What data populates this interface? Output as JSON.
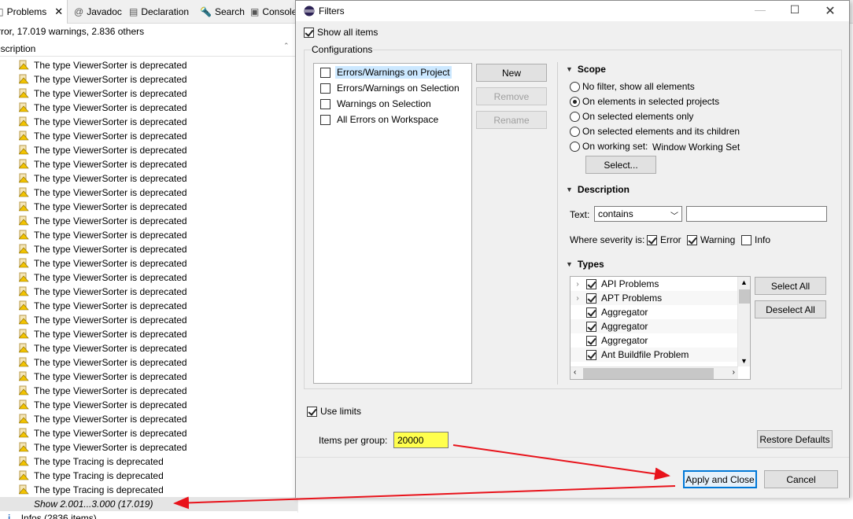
{
  "view": {
    "tabs": [
      {
        "label": "Problems"
      },
      {
        "label": "Javadoc"
      },
      {
        "label": "Declaration"
      },
      {
        "label": "Search"
      },
      {
        "label": "Console"
      }
    ],
    "summary": "rror, 17.019 warnings, 2.836 others",
    "column_header": "escription",
    "rows": [
      "The type ViewerSorter is deprecated",
      "The type ViewerSorter is deprecated",
      "The type ViewerSorter is deprecated",
      "The type ViewerSorter is deprecated",
      "The type ViewerSorter is deprecated",
      "The type ViewerSorter is deprecated",
      "The type ViewerSorter is deprecated",
      "The type ViewerSorter is deprecated",
      "The type ViewerSorter is deprecated",
      "The type ViewerSorter is deprecated",
      "The type ViewerSorter is deprecated",
      "The type ViewerSorter is deprecated",
      "The type ViewerSorter is deprecated",
      "The type ViewerSorter is deprecated",
      "The type ViewerSorter is deprecated",
      "The type ViewerSorter is deprecated",
      "The type ViewerSorter is deprecated",
      "The type ViewerSorter is deprecated",
      "The type ViewerSorter is deprecated",
      "The type ViewerSorter is deprecated",
      "The type ViewerSorter is deprecated",
      "The type ViewerSorter is deprecated",
      "The type ViewerSorter is deprecated",
      "The type ViewerSorter is deprecated",
      "The type ViewerSorter is deprecated",
      "The type ViewerSorter is deprecated",
      "The type ViewerSorter is deprecated",
      "The type ViewerSorter is deprecated",
      "The type Tracing is deprecated",
      "The type Tracing is deprecated",
      "The type Tracing is deprecated"
    ],
    "show_more": "Show 2.001...3.000 (17.019)",
    "infos": "Infos (2836 items)"
  },
  "dialog": {
    "title": "Filters",
    "show_all_items": "Show all items",
    "configurations_label": "Configurations",
    "configurations": [
      {
        "label": "Errors/Warnings on Project",
        "checked": false,
        "selected": true
      },
      {
        "label": "Errors/Warnings on Selection",
        "checked": false,
        "selected": false
      },
      {
        "label": "Warnings on Selection",
        "checked": false,
        "selected": false
      },
      {
        "label": "All Errors on Workspace",
        "checked": false,
        "selected": false
      }
    ],
    "buttons": {
      "new": "New",
      "remove": "Remove",
      "rename": "Rename"
    },
    "scope": {
      "title": "Scope",
      "options": [
        "No filter, show all elements",
        "On elements in selected projects",
        "On selected elements only",
        "On selected elements and its children",
        "On working set:"
      ],
      "selected_index": 1,
      "working_set": "Window Working Set",
      "select_button": "Select..."
    },
    "description": {
      "title": "Description",
      "text_label": "Text:",
      "operator": "contains",
      "text_value": "",
      "severity_label": "Where severity is:",
      "error": "Error",
      "warning": "Warning",
      "info": "Info"
    },
    "types": {
      "title": "Types",
      "items": [
        {
          "label": "API Problems",
          "expandable": true
        },
        {
          "label": "APT Problems",
          "expandable": true
        },
        {
          "label": "Aggregator",
          "expandable": false
        },
        {
          "label": "Aggregator",
          "expandable": false
        },
        {
          "label": "Aggregator",
          "expandable": false
        },
        {
          "label": "Ant Buildfile Problem",
          "expandable": false
        }
      ],
      "select_all": "Select All",
      "deselect_all": "Deselect All"
    },
    "use_limits": "Use limits",
    "items_per_group_label": "Items per group:",
    "items_per_group": "20000",
    "restore_defaults": "Restore Defaults",
    "apply_and_close": "Apply and Close",
    "cancel": "Cancel"
  },
  "colors": {
    "highlight": "#ffff4d",
    "arrow": "#e8131b",
    "accent": "#0078d7"
  }
}
